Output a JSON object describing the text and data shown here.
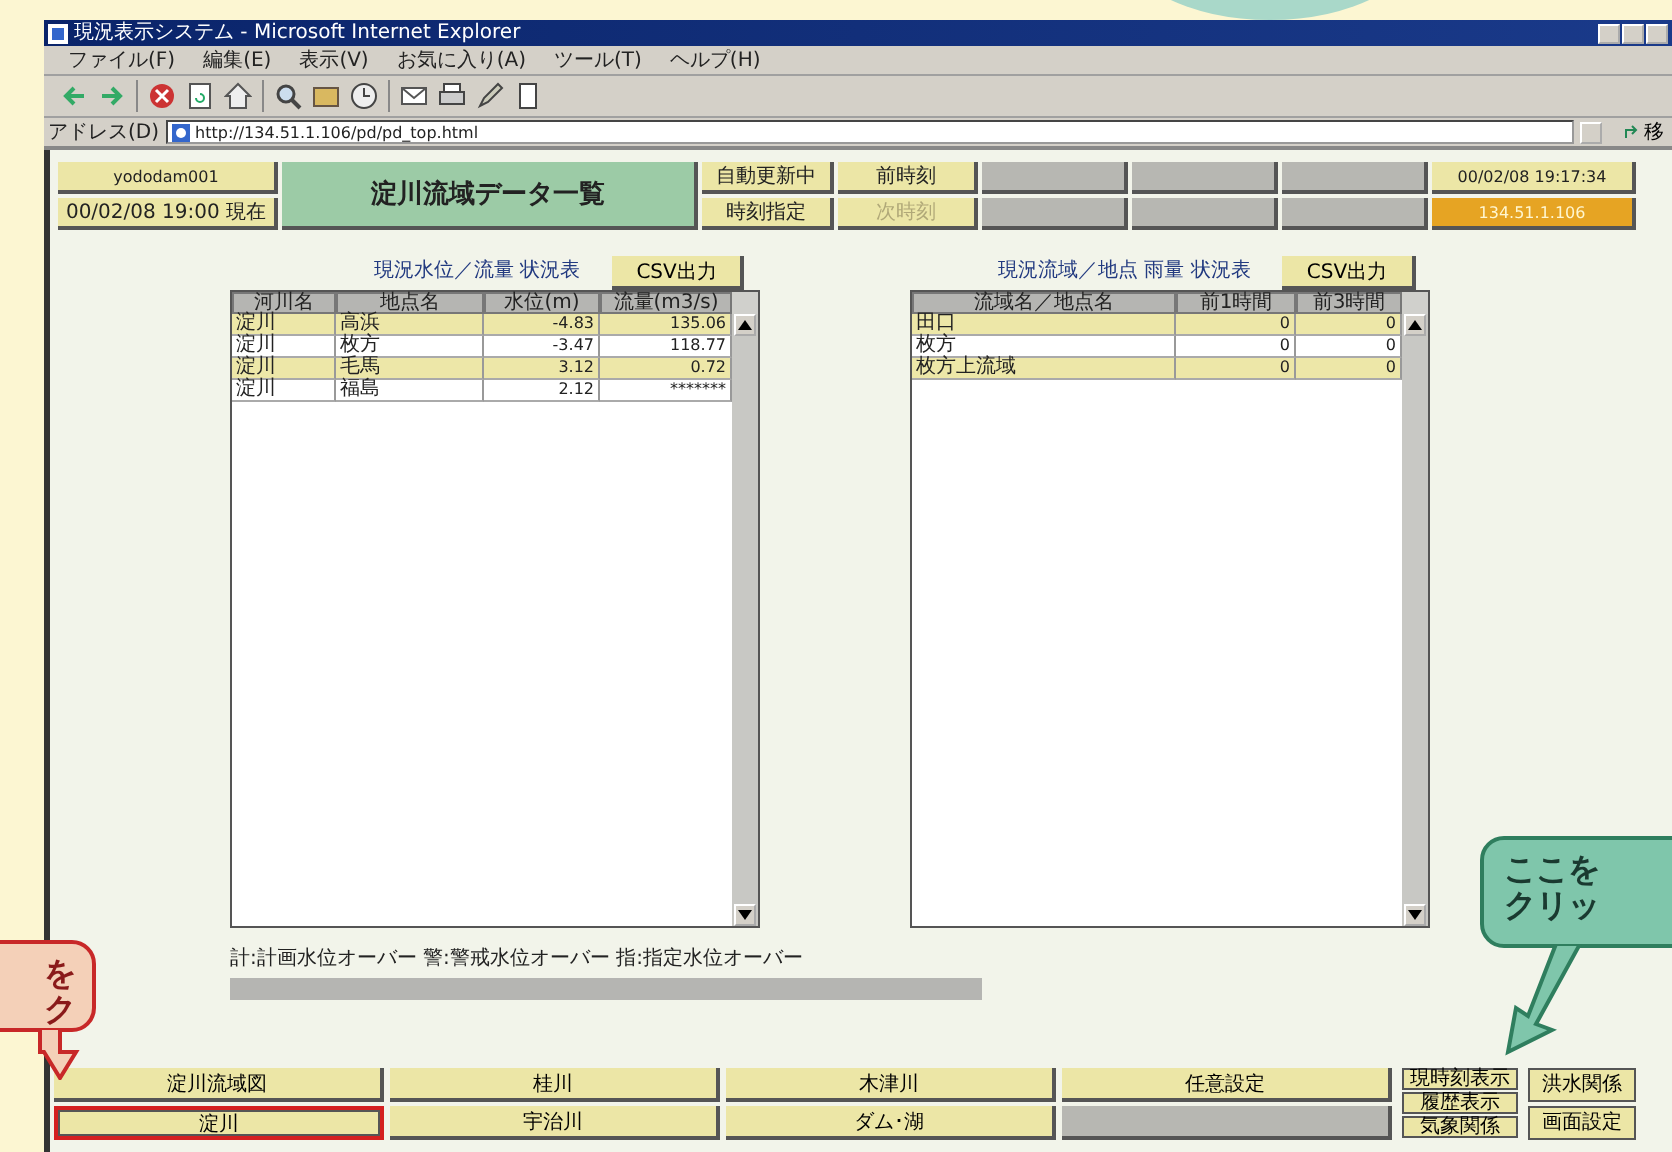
{
  "window": {
    "title": "現況表示システム - Microsoft Internet Explorer"
  },
  "menu": [
    "ファイル(F)",
    "編集(E)",
    "表示(V)",
    "お気に入り(A)",
    "ツール(T)",
    "ヘルプ(H)"
  ],
  "address": {
    "label": "アドレス(D)",
    "url": "http://134.51.1.106/pd/pd_top.html",
    "go": "移"
  },
  "header": {
    "user": "yododam001",
    "as_of": "00/02/08 19:00 現在",
    "title": "淀川流域データ一覧",
    "clock": "00/02/08 19:17:34",
    "host": "134.51.1.106",
    "buttons": [
      {
        "label": "自動更新中",
        "disabled": false
      },
      {
        "label": "前時刻",
        "disabled": false
      },
      {
        "label": "時刻指定",
        "disabled": false
      },
      {
        "label": "次時刻",
        "disabled": true
      }
    ]
  },
  "water_table": {
    "title": "現況水位／流量 状況表",
    "csv_button": "CSV出力",
    "columns": [
      "河川名",
      "地点名",
      "水位(m)",
      "流量(m3/s)"
    ],
    "rows": [
      [
        "淀川",
        "高浜",
        "-4.83",
        "135.06"
      ],
      [
        "淀川",
        "枚方",
        "-3.47",
        "118.77"
      ],
      [
        "淀川",
        "毛馬",
        "3.12",
        "0.72"
      ],
      [
        "淀川",
        "福島",
        "2.12",
        "*******"
      ]
    ]
  },
  "rain_table": {
    "title": "現況流域／地点 雨量 状況表",
    "csv_button": "CSV出力",
    "columns": [
      "流域名／地点名",
      "前1時間",
      "前3時間"
    ],
    "rows": [
      [
        "田口",
        "0",
        "0"
      ],
      [
        "枚方",
        "0",
        "0"
      ],
      [
        "枚方上流域",
        "0",
        "0"
      ]
    ]
  },
  "legend": "計:計画水位オーバー 警:警戒水位オーバー 指:指定水位オーバー",
  "nav": [
    [
      {
        "label": "淀川流域図",
        "highlighted": false
      },
      {
        "label": "桂川",
        "highlighted": false
      },
      {
        "label": "木津川",
        "highlighted": false
      },
      {
        "label": "任意設定",
        "highlighted": false
      }
    ],
    [
      {
        "label": "淀川",
        "highlighted": true
      },
      {
        "label": "宇治川",
        "highlighted": false
      },
      {
        "label": "ダム･湖",
        "highlighted": false
      },
      {
        "kind": "blank"
      }
    ]
  ],
  "side_buttons": [
    "現時刻表示",
    "履歴表示",
    "気象関係"
  ],
  "side_buttons_right": [
    "洪水関係",
    "画面設定"
  ],
  "callouts": [
    {
      "kind": "red",
      "lines": [
        "を",
        "ク"
      ]
    },
    {
      "kind": "green",
      "lines": [
        "ここを",
        "クリッ"
      ]
    }
  ]
}
